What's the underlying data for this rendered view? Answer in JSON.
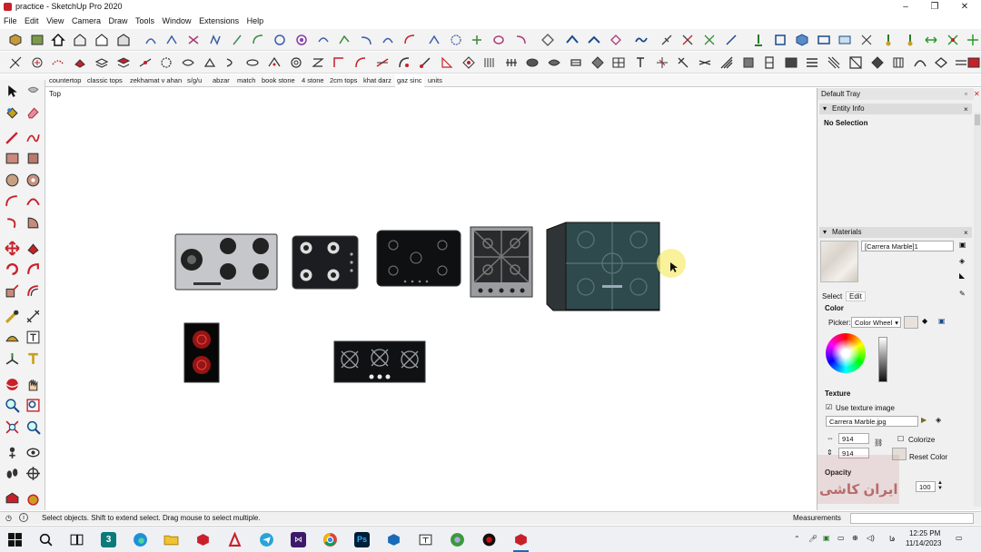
{
  "window": {
    "title": "practice - SketchUp Pro 2020",
    "minimize": "–",
    "maximize": "❐",
    "close": "✕"
  },
  "menu": [
    "File",
    "Edit",
    "View",
    "Camera",
    "Draw",
    "Tools",
    "Window",
    "Extensions",
    "Help"
  ],
  "scene_tabs": [
    "countertop",
    "classic tops",
    "zekhamat v ahan",
    "s/g/u",
    "abzar",
    "match",
    "book stone",
    "4 stone",
    "2cm tops",
    "khat darz",
    "gaz sinc",
    "units"
  ],
  "active_scene": "gaz sinc",
  "viewport": {
    "view_label": "Top"
  },
  "tray": {
    "title": "Default Tray",
    "entity_info": {
      "title": "Entity Info",
      "selection": "No Selection"
    },
    "materials": {
      "title": "Materials",
      "material_name": "[Carrera Marble]1",
      "tab_select": "Select",
      "tab_edit": "Edit",
      "color_label": "Color",
      "picker_label": "Picker:",
      "picker_value": "Color Wheel",
      "texture_label": "Texture",
      "use_texture": "Use texture image",
      "texture_file": "Carrera Marble.jpg",
      "width_value": "914",
      "height_value": "914",
      "colorize": "Colorize",
      "reset_color": "Reset Color",
      "opacity_label": "Opacity",
      "opacity_value": "100"
    },
    "watermark": "ایران کاشی"
  },
  "status": {
    "hint": "Select objects. Shift to extend select. Drag mouse to select multiple.",
    "measurements": "Measurements",
    "info": "i"
  },
  "clock": {
    "time": "12:25 PM",
    "date": "11/14/2023",
    "lang": "فا",
    "badge": "3"
  },
  "colors": {
    "accent": "#c8202a",
    "taskbar": "#eef0f4",
    "stove_teal": "#2f4a4c"
  }
}
